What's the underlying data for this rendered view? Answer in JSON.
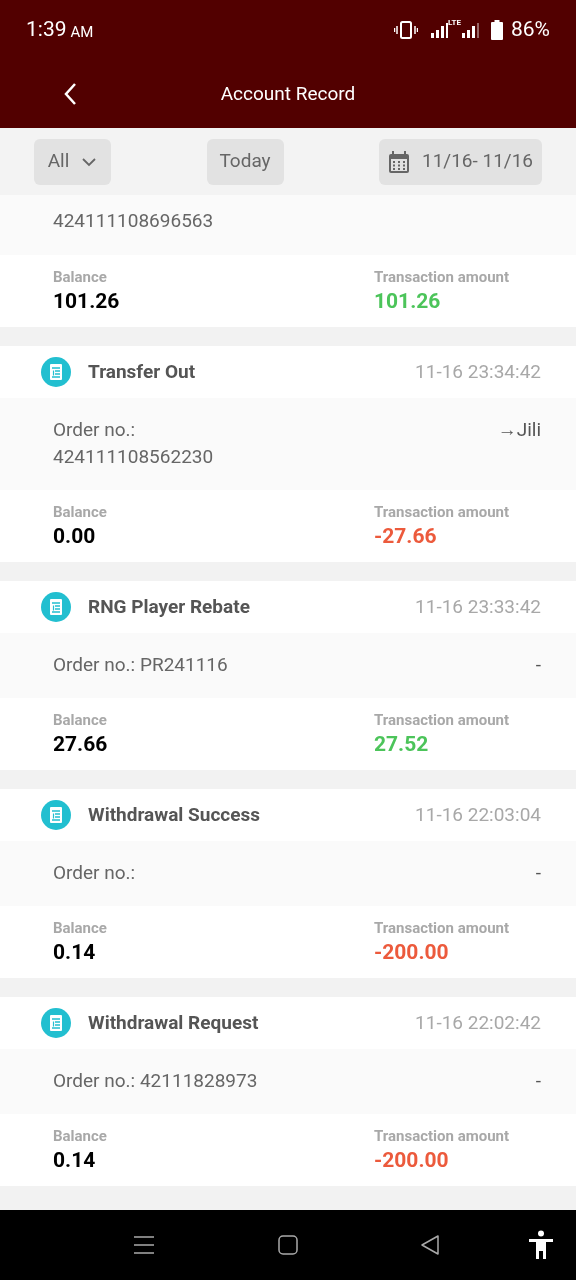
{
  "status_bar": {
    "time": "1:39",
    "meridiem": "AM",
    "network": "LTE",
    "battery": "86%"
  },
  "header": {
    "title": "Account Record"
  },
  "filters": {
    "type": "All",
    "period": "Today",
    "date_range": "11/16- 11/16"
  },
  "partial_record": {
    "order_number": "424111108696563",
    "balance_label": "Balance",
    "balance": "101.26",
    "amount_label": "Transaction amount",
    "amount": "101.26",
    "color": "#4cc45a"
  },
  "records": [
    {
      "title": "Transfer Out",
      "time": "11-16 23:34:42",
      "kind": "stacked",
      "order_label": "Order no.:",
      "order_number": "424111108562230",
      "note": "→Jili",
      "balance_label": "Balance",
      "balance": "0.00",
      "amount_label": "Transaction amount",
      "amount": "-27.66",
      "color": "#ec5a3c"
    },
    {
      "title": "RNG Player Rebate",
      "time": "11-16 23:33:42",
      "kind": "inline",
      "order_label": "Order no.:",
      "order_number": "PR241116",
      "note": "-",
      "balance_label": "Balance",
      "balance": "27.66",
      "amount_label": "Transaction amount",
      "amount": "27.52",
      "color": "#4cc45a"
    },
    {
      "title": "Withdrawal Success",
      "time": "11-16 22:03:04",
      "kind": "inline",
      "order_label": "Order no.:",
      "note": "-",
      "balance_label": "Balance",
      "balance": "0.14",
      "amount_label": "Transaction amount",
      "amount": "-200.00",
      "color": "#ec5a3c"
    },
    {
      "title": "Withdrawal Request",
      "time": "11-16 22:02:42",
      "kind": "inline",
      "order_label": "Order no.:",
      "order_number": "42111828973",
      "note": "-",
      "balance_label": "Balance",
      "balance": "0.14",
      "amount_label": "Transaction amount",
      "amount": "-200.00",
      "color": "#ec5a3c"
    }
  ]
}
